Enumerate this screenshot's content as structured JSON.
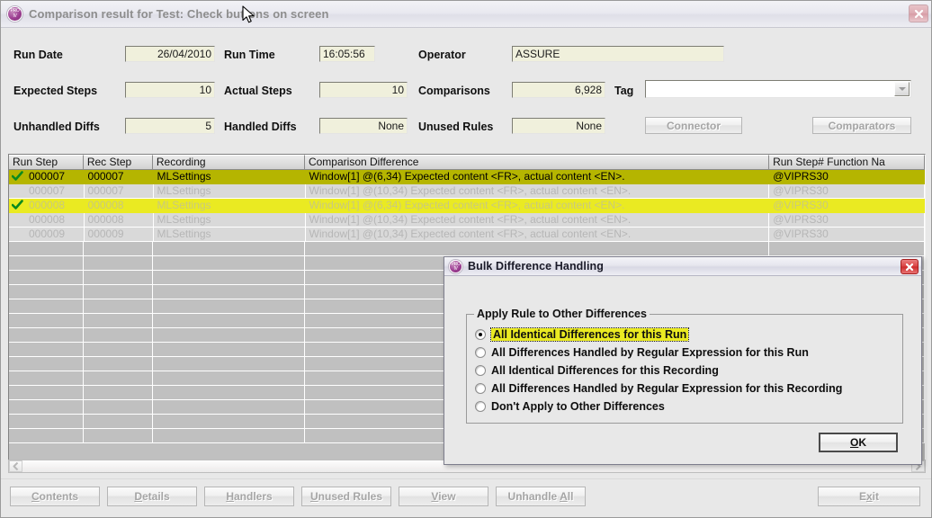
{
  "window": {
    "title": "Comparison result for Test: Check buttons on screen",
    "app_icon": "proiv-logo-icon",
    "icon_line1": "PRO",
    "icon_line2": "IV",
    "close_label": "close-icon"
  },
  "form": {
    "run_date_label": "Run Date",
    "run_date_value": "26/04/2010",
    "run_time_label": "Run Time",
    "run_time_value": "16:05:56",
    "operator_label": "Operator",
    "operator_value": "ASSURE",
    "expected_steps_label": "Expected Steps",
    "expected_steps_value": "10",
    "actual_steps_label": "Actual Steps",
    "actual_steps_value": "10",
    "comparisons_label": "Comparisons",
    "comparisons_value": "6,928",
    "tag_label": "Tag",
    "tag_value": "",
    "unhandled_diffs_label": "Unhandled Diffs",
    "unhandled_diffs_value": "5",
    "handled_diffs_label": "Handled Diffs",
    "handled_diffs_value": "None",
    "unused_rules_label": "Unused Rules",
    "unused_rules_value": "None",
    "connector_button": "Connector",
    "comparators_button": "Comparators"
  },
  "grid": {
    "columns": [
      "Run Step",
      "Rec Step",
      "Recording",
      "Comparison Difference",
      "Run Step# Function Na"
    ],
    "rows": [
      {
        "state": "sel",
        "checked": true,
        "run_step": "000007",
        "rec_step": "000007",
        "recording": "MLSettings",
        "difference": "Window[1] @(6,34) Expected content <FR>, actual content <EN>.",
        "function": "@VIPRS30"
      },
      {
        "state": "dim",
        "checked": false,
        "run_step": "000007",
        "rec_step": "000007",
        "recording": "MLSettings",
        "difference": "Window[1] @(10,34) Expected content <FR>, actual content <EN>.",
        "function": "@VIPRS30"
      },
      {
        "state": "hl",
        "checked": true,
        "run_step": "000008",
        "rec_step": "000008",
        "recording": "MLSettings",
        "difference": "Window[1] @(6,34) Expected content <FR>, actual content <EN>.",
        "function": "@VIPRS30"
      },
      {
        "state": "dim",
        "checked": false,
        "run_step": "000008",
        "rec_step": "000008",
        "recording": "MLSettings",
        "difference": "Window[1] @(10,34) Expected content <FR>, actual content <EN>.",
        "function": "@VIPRS30"
      },
      {
        "state": "dim",
        "checked": false,
        "run_step": "000009",
        "rec_step": "000009",
        "recording": "MLSettings",
        "difference": "Window[1] @(10,34) Expected content <FR>, actual content <EN>.",
        "function": "@VIPRS30"
      }
    ],
    "blank_row_count": 14
  },
  "dialog": {
    "title": "Bulk Difference Handling",
    "icon_line1": "PRO",
    "icon_line2": "IV",
    "groupbox_legend": "Apply Rule to Other Differences",
    "options": [
      {
        "label": "All Identical Differences for this Run",
        "selected": true
      },
      {
        "label": "All Differences Handled by Regular Expression for this Run",
        "selected": false
      },
      {
        "label": "All Identical Differences for this Recording",
        "selected": false
      },
      {
        "label": "All Differences Handled by Regular Expression for this Recording",
        "selected": false
      },
      {
        "label": "Don't Apply to Other Differences",
        "selected": false
      }
    ],
    "ok_mnemonic": "O",
    "ok_rest": "K"
  },
  "bottom_buttons": [
    {
      "mnemonic": "C",
      "pre": "",
      "rest": "ontents",
      "enabled": false
    },
    {
      "mnemonic": "D",
      "pre": "",
      "rest": "etails",
      "enabled": false
    },
    {
      "mnemonic": "H",
      "pre": "",
      "rest": "andlers",
      "enabled": false
    },
    {
      "mnemonic": "U",
      "pre": "",
      "rest": "nused Rules",
      "enabled": false
    },
    {
      "mnemonic": "V",
      "pre": "",
      "rest": "iew",
      "enabled": false
    },
    {
      "mnemonic": "A",
      "pre": "Unhandle ",
      "rest": "ll",
      "enabled": false
    }
  ],
  "exit_button": {
    "pre": "E",
    "mnemonic": "x",
    "rest": "it",
    "enabled": false
  },
  "colors": {
    "selected_row": "#b5b500",
    "highlight_row": "#eaea22",
    "field_bg": "#f0f0dc",
    "window_bg": "#e8e8e8",
    "grid_bg": "#c0c0c0"
  }
}
